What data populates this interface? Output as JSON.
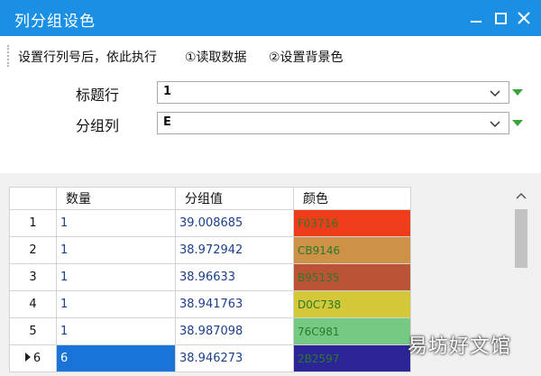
{
  "window": {
    "title": "列分组设色"
  },
  "toolbar": {
    "items": [
      "设置行列号后，依此执行",
      "①读取数据",
      "②设置背景色"
    ]
  },
  "form": {
    "header_row_label": "标题行",
    "header_row_value": "1",
    "group_col_label": "分组列",
    "group_col_value": "E"
  },
  "grid": {
    "columns": [
      "",
      "数量",
      "分组值",
      "颜色"
    ],
    "rows": [
      {
        "num": "1",
        "qty": "1",
        "group_value": "39.008685",
        "color_hex": "F03716",
        "bg": "#ef3d1b"
      },
      {
        "num": "2",
        "qty": "1",
        "group_value": "38.972942",
        "color_hex": "CB9146",
        "bg": "#cd9148"
      },
      {
        "num": "3",
        "qty": "1",
        "group_value": "38.96633",
        "color_hex": "B95135",
        "bg": "#bb5336"
      },
      {
        "num": "4",
        "qty": "1",
        "group_value": "38.941763",
        "color_hex": "D0C738",
        "bg": "#d4c738"
      },
      {
        "num": "5",
        "qty": "1",
        "group_value": "38.987098",
        "color_hex": "76C981",
        "bg": "#76c982"
      },
      {
        "num": "6",
        "qty": "6",
        "group_value": "38.946273",
        "color_hex": "2B2597",
        "bg": "#2b2597"
      }
    ]
  },
  "watermark": "易坊好文馆"
}
